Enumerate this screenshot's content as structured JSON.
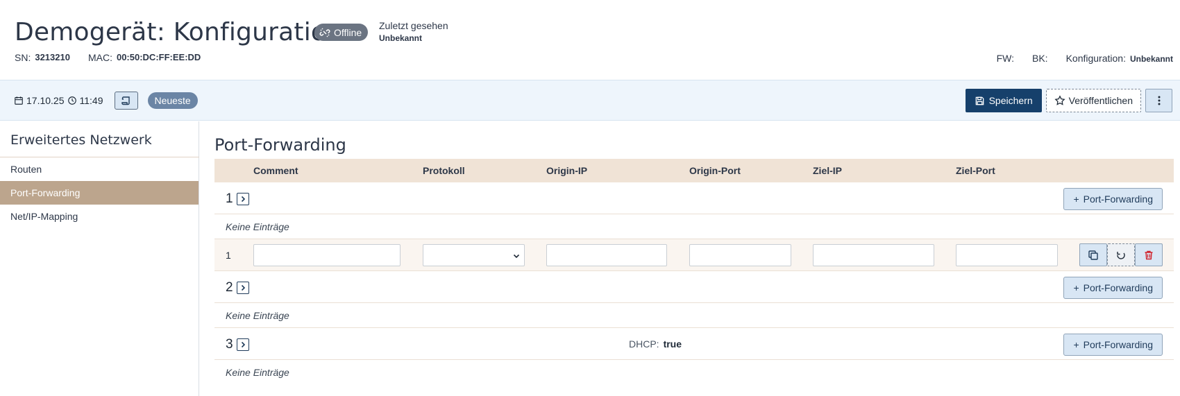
{
  "header": {
    "title": "Demogerät: Konfiguration",
    "status_badge": "Offline",
    "last_seen_label": "Zuletzt gesehen",
    "last_seen_value": "Unbekannt",
    "sn_label": "SN:",
    "sn_value": "3213210",
    "mac_label": "MAC:",
    "mac_value": "00:50:DC:FF:EE:DD",
    "fw_label": "FW:",
    "bk_label": "BK:",
    "config_label": "Konfiguration:",
    "config_value": "Unbekannt"
  },
  "toolbar": {
    "date": "17.10.25",
    "time": "11:49",
    "version_badge": "Neueste",
    "save_label": "Speichern",
    "publish_label": "Veröffentlichen"
  },
  "sidebar": {
    "title": "Erweitertes Netzwerk",
    "items": [
      {
        "label": "Routen",
        "active": false
      },
      {
        "label": "Port-Forwarding",
        "active": true
      },
      {
        "label": "Net/IP-Mapping",
        "active": false
      }
    ]
  },
  "main": {
    "title": "Port-Forwarding",
    "columns": [
      "Comment",
      "Protokoll",
      "Origin-IP",
      "Origin-Port",
      "Ziel-IP",
      "Ziel-Port"
    ],
    "add_label": "Port-Forwarding",
    "empty_label": "Keine Einträge",
    "groups": [
      {
        "number": "1"
      },
      {
        "number": "2"
      },
      {
        "number": "3",
        "dhcp_label": "DHCP:",
        "dhcp_value": "true"
      }
    ],
    "row": {
      "index": "1",
      "comment": "",
      "protocol": "",
      "origin_ip": "",
      "origin_port": "",
      "target_ip": "",
      "target_port": ""
    }
  },
  "colors": {
    "primary": "#16406b",
    "accent_active": "#bca58d",
    "table_header": "#f0e3d6",
    "toolbar_bg": "#eef5fc",
    "delete": "#d0212b"
  }
}
